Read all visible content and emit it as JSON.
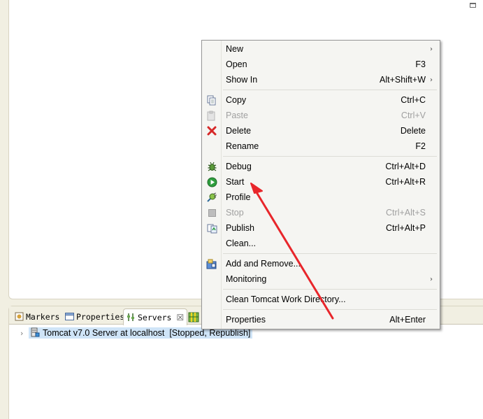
{
  "tabs": [
    {
      "label": "Markers",
      "icon": "markers-icon",
      "active": false
    },
    {
      "label": "Properties",
      "icon": "properties-icon",
      "active": false
    },
    {
      "label": "Servers",
      "icon": "servers-icon",
      "active": true
    }
  ],
  "tree": {
    "server_label": "Tomcat v7.0 Server at localhost  [Stopped, Republish]"
  },
  "menu": {
    "new": {
      "label": "New",
      "shortcut": ""
    },
    "open": {
      "label": "Open",
      "shortcut": "F3"
    },
    "show_in": {
      "label": "Show In",
      "shortcut": "Alt+Shift+W"
    },
    "copy": {
      "label": "Copy",
      "shortcut": "Ctrl+C",
      "icon": "copy-icon"
    },
    "paste": {
      "label": "Paste",
      "shortcut": "Ctrl+V",
      "icon": "paste-icon",
      "disabled": true
    },
    "delete": {
      "label": "Delete",
      "shortcut": "Delete",
      "icon": "delete-icon"
    },
    "rename": {
      "label": "Rename",
      "shortcut": "F2"
    },
    "debug": {
      "label": "Debug",
      "shortcut": "Ctrl+Alt+D",
      "icon": "debug-icon"
    },
    "start": {
      "label": "Start",
      "shortcut": "Ctrl+Alt+R",
      "icon": "start-icon"
    },
    "profile": {
      "label": "Profile",
      "shortcut": "",
      "icon": "profile-icon"
    },
    "stop": {
      "label": "Stop",
      "shortcut": "Ctrl+Alt+S",
      "icon": "stop-icon",
      "disabled": true
    },
    "publish": {
      "label": "Publish",
      "shortcut": "Ctrl+Alt+P",
      "icon": "publish-icon"
    },
    "clean": {
      "label": "Clean...",
      "shortcut": ""
    },
    "add_remove": {
      "label": "Add and Remove...",
      "shortcut": "",
      "icon": "add-remove-icon"
    },
    "monitoring": {
      "label": "Monitoring",
      "shortcut": ""
    },
    "clean_work_dir": {
      "label": "Clean Tomcat Work Directory...",
      "shortcut": ""
    },
    "properties": {
      "label": "Properties",
      "shortcut": "Alt+Enter"
    }
  },
  "colors": {
    "annotation_arrow": "#e8262b",
    "selection": "#cfe4f7",
    "start_icon": "#2e9e3e",
    "delete_icon": "#d62828"
  }
}
